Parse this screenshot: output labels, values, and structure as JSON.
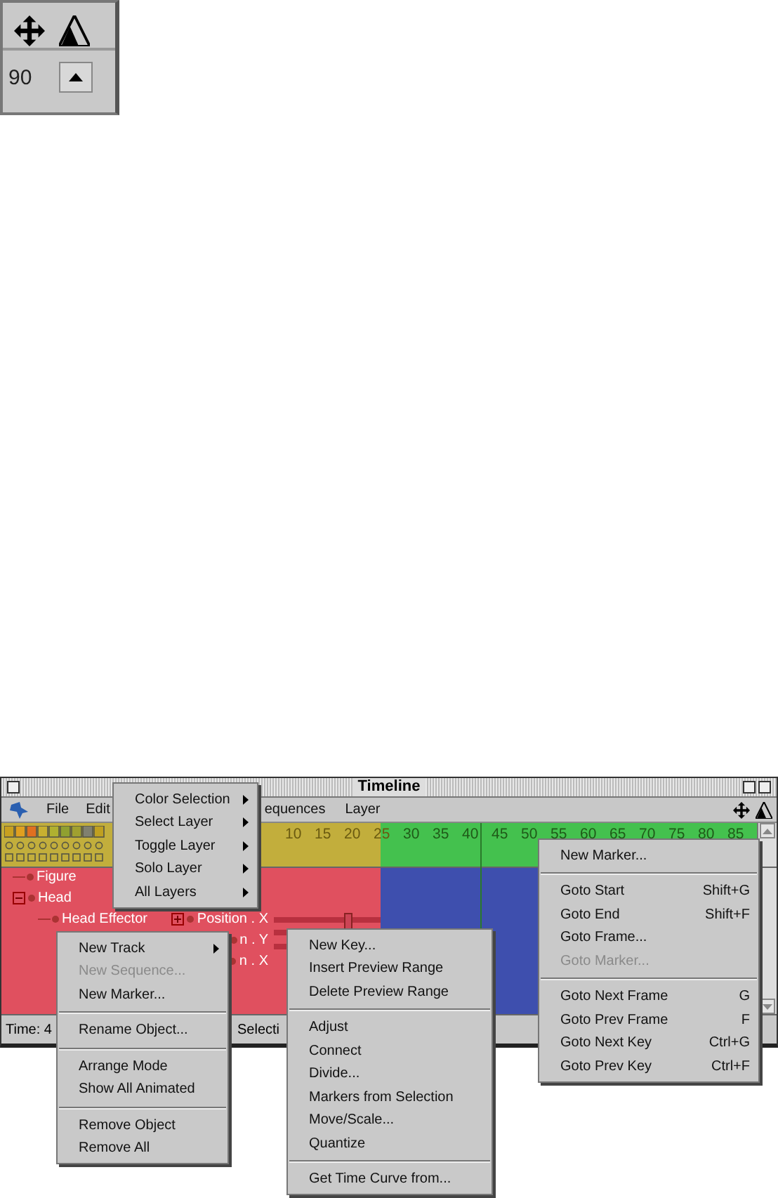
{
  "toolbox": {
    "field_value": "90"
  },
  "timeline": {
    "title": "Timeline",
    "menu_bar": [
      "File",
      "Edit",
      "equences",
      "Layer"
    ],
    "ruler_ticks": [
      "10",
      "15",
      "20",
      "25",
      "30",
      "35",
      "40",
      "45",
      "50",
      "55",
      "60",
      "65",
      "70",
      "75",
      "80",
      "85"
    ],
    "tree": [
      {
        "label": "Figure"
      },
      {
        "label": "Head",
        "expanded": true,
        "children": [
          {
            "label": "Head Effector"
          }
        ]
      }
    ],
    "channels": [
      {
        "label": "Position . X",
        "expanded": false
      },
      {
        "label": "n . Y"
      },
      {
        "label": "n . X"
      }
    ],
    "status": [
      "Time: 4",
      "Selecti"
    ]
  },
  "menus": [
    {
      "items": [
        {
          "kind": "item",
          "label": "Color Selection",
          "submenu": true,
          "disabled": false
        },
        {
          "kind": "item",
          "label": "Select Layer",
          "submenu": true,
          "disabled": false
        },
        {
          "kind": "item",
          "label": "Toggle Layer",
          "submenu": true,
          "disabled": false
        },
        {
          "kind": "item",
          "label": "Solo Layer",
          "submenu": true,
          "disabled": false
        },
        {
          "kind": "item",
          "label": "All Layers",
          "submenu": true,
          "disabled": false
        }
      ]
    },
    {
      "items": [
        {
          "kind": "item",
          "label": "New Track",
          "submenu": true,
          "disabled": false
        },
        {
          "kind": "item",
          "label": "New Sequence...",
          "submenu": false,
          "disabled": true
        },
        {
          "kind": "item",
          "label": "New Marker...",
          "submenu": false,
          "disabled": false
        },
        {
          "kind": "separator"
        },
        {
          "kind": "item",
          "label": "Rename Object...",
          "submenu": false,
          "disabled": false
        },
        {
          "kind": "separator"
        },
        {
          "kind": "item",
          "label": "Arrange Mode",
          "submenu": false,
          "disabled": false
        },
        {
          "kind": "item",
          "label": "Show All Animated",
          "submenu": false,
          "disabled": false
        },
        {
          "kind": "separator"
        },
        {
          "kind": "item",
          "label": "Remove Object",
          "submenu": false,
          "disabled": false
        },
        {
          "kind": "item",
          "label": "Remove All",
          "submenu": false,
          "disabled": false
        }
      ]
    },
    {
      "items": [
        {
          "kind": "item",
          "label": "New Key...",
          "submenu": false,
          "disabled": false
        },
        {
          "kind": "item",
          "label": "Insert Preview Range",
          "submenu": false,
          "disabled": false
        },
        {
          "kind": "item",
          "label": "Delete Preview Range",
          "submenu": false,
          "disabled": false
        },
        {
          "kind": "separator"
        },
        {
          "kind": "item",
          "label": "Adjust",
          "submenu": false,
          "disabled": false
        },
        {
          "kind": "item",
          "label": "Connect",
          "submenu": false,
          "disabled": false
        },
        {
          "kind": "item",
          "label": "Divide...",
          "submenu": false,
          "disabled": false
        },
        {
          "kind": "item",
          "label": "Markers from Selection",
          "submenu": false,
          "disabled": false
        },
        {
          "kind": "item",
          "label": "Move/Scale...",
          "submenu": false,
          "disabled": false
        },
        {
          "kind": "item",
          "label": "Quantize",
          "submenu": false,
          "disabled": false
        },
        {
          "kind": "separator"
        },
        {
          "kind": "item",
          "label": "Get Time Curve from...",
          "submenu": false,
          "disabled": false
        }
      ]
    },
    {
      "items": [
        {
          "kind": "item",
          "label": "New Marker...",
          "submenu": false,
          "disabled": false
        },
        {
          "kind": "separator"
        },
        {
          "kind": "item",
          "label": "Goto Start",
          "shortcut": "Shift+G",
          "submenu": false,
          "disabled": false
        },
        {
          "kind": "item",
          "label": "Goto End",
          "shortcut": "Shift+F",
          "submenu": false,
          "disabled": false
        },
        {
          "kind": "item",
          "label": "Goto Frame...",
          "submenu": false,
          "disabled": false
        },
        {
          "kind": "item",
          "label": "Goto Marker...",
          "submenu": false,
          "disabled": true
        },
        {
          "kind": "separator"
        },
        {
          "kind": "item",
          "label": "Goto Next Frame",
          "shortcut": "G",
          "submenu": false,
          "disabled": false
        },
        {
          "kind": "item",
          "label": "Goto Prev Frame",
          "shortcut": "F",
          "submenu": false,
          "disabled": false
        },
        {
          "kind": "item",
          "label": "Goto Next Key",
          "shortcut": "Ctrl+G",
          "submenu": false,
          "disabled": false
        },
        {
          "kind": "item",
          "label": "Goto Prev Key",
          "shortcut": "Ctrl+F",
          "submenu": false,
          "disabled": false
        }
      ]
    }
  ]
}
